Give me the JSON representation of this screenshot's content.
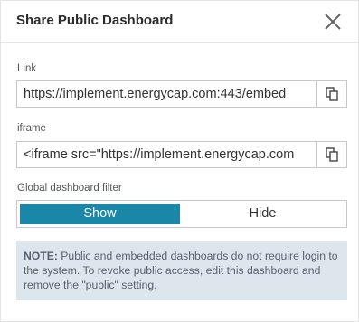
{
  "dialog": {
    "title": "Share Public Dashboard",
    "close_icon": "close-icon"
  },
  "link": {
    "label": "Link",
    "value": "https://implement.energycap.com:443/embed",
    "copy_icon": "copy-icon"
  },
  "iframe": {
    "label": "iframe",
    "value": "<iframe src=\"https://implement.energycap.com",
    "copy_icon": "copy-icon"
  },
  "filter": {
    "label": "Global dashboard filter",
    "options": [
      "Show",
      "Hide"
    ],
    "selected": "Show"
  },
  "note": {
    "prefix": "NOTE:",
    "text": " Public and embedded dashboards do not require login to the system. To revoke public access, edit this dashboard and remove the \"public\" setting."
  },
  "colors": {
    "accent": "#1a87a8",
    "note_background": "#dde6ed"
  }
}
